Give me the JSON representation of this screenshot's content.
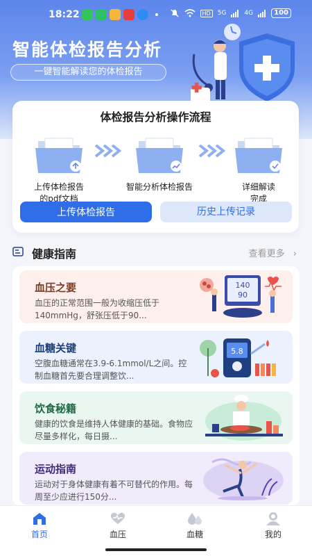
{
  "status": {
    "time": "18:22",
    "battery": "100",
    "network": "HD",
    "signal1": "5G",
    "signal2": "4G"
  },
  "hero": {
    "title": "智能体检报告分析",
    "subtitle": "一键智能解读您的体检报告"
  },
  "flow": {
    "title": "体检报告分析操作流程",
    "steps": [
      {
        "line1": "上传体检报告",
        "line2": "的pdf文档",
        "icon": "folder-upload-icon"
      },
      {
        "line1": "智能分析体检报告",
        "line2": "",
        "icon": "folder-chart-icon"
      },
      {
        "line1": "详细解读",
        "line2": "完成",
        "icon": "folder-check-icon"
      }
    ],
    "upload_button": "上传体检报告",
    "history_button": "历史上传记录"
  },
  "guide": {
    "title": "健康指南",
    "more": "查看更多",
    "cards": [
      {
        "title": "血压之要",
        "desc": "血压的正常范围一般为收缩压低于140mmHg，舒张压低于90...",
        "bg": "#fdf0ec",
        "color": "#7a3a1f"
      },
      {
        "title": "血糖关键",
        "desc": "空腹血糖通常在3.9-6.1mmol/L之间。控制血糖首先要合理调整饮...",
        "bg": "#ebf1fd",
        "color": "#1f3f80"
      },
      {
        "title": "饮食秘籍",
        "desc": "健康的饮食是维持人体健康的基础。食物应尽量多样化，每日摄...",
        "bg": "#e9f7f0",
        "color": "#1f6a44"
      },
      {
        "title": "运动指南",
        "desc": "运动对于身体健康有着不可替代的作用。每周至少应进行150分...",
        "bg": "#f0ecfb",
        "color": "#3d2a7a"
      }
    ],
    "glucometer_value": "5.8",
    "bp_display": [
      "140",
      "90"
    ]
  },
  "tabs": [
    {
      "label": "首页",
      "icon": "home-icon",
      "active": true
    },
    {
      "label": "血压",
      "icon": "heart-icon",
      "active": false
    },
    {
      "label": "血糖",
      "icon": "drops-icon",
      "active": false
    },
    {
      "label": "我的",
      "icon": "profile-icon",
      "active": false
    }
  ],
  "colors": {
    "primary": "#2f6ee8",
    "hero_top": "#5d86ec",
    "secondary_bg": "#dde7fb"
  }
}
